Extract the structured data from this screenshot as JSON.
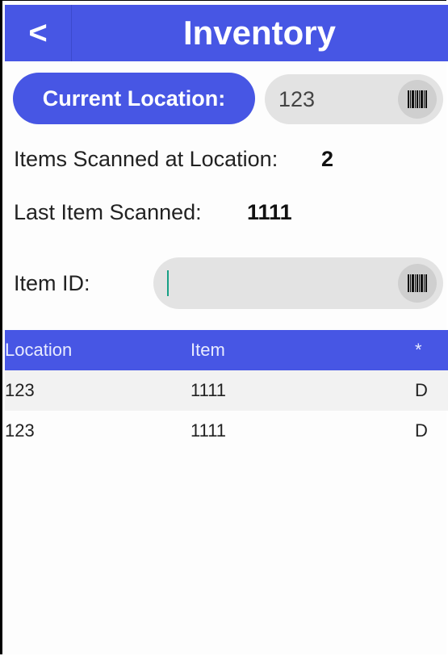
{
  "header": {
    "back_label": "<",
    "title": "Inventory"
  },
  "location": {
    "button_label": "Current Location:",
    "value": "123"
  },
  "stats": {
    "items_scanned_label": "Items Scanned at Location:",
    "items_scanned_value": "2",
    "last_item_label": "Last Item Scanned:",
    "last_item_value": "1111"
  },
  "item_input": {
    "label": "Item ID:",
    "value": ""
  },
  "table": {
    "headers": [
      "Location",
      "Item",
      "*"
    ],
    "rows": [
      [
        "123",
        "1111",
        "D"
      ],
      [
        "123",
        "1111",
        "D"
      ]
    ]
  },
  "icons": {
    "scan": "barcode-icon"
  },
  "colors": {
    "accent": "#4756e4",
    "input_bg": "#e3e3e3"
  }
}
